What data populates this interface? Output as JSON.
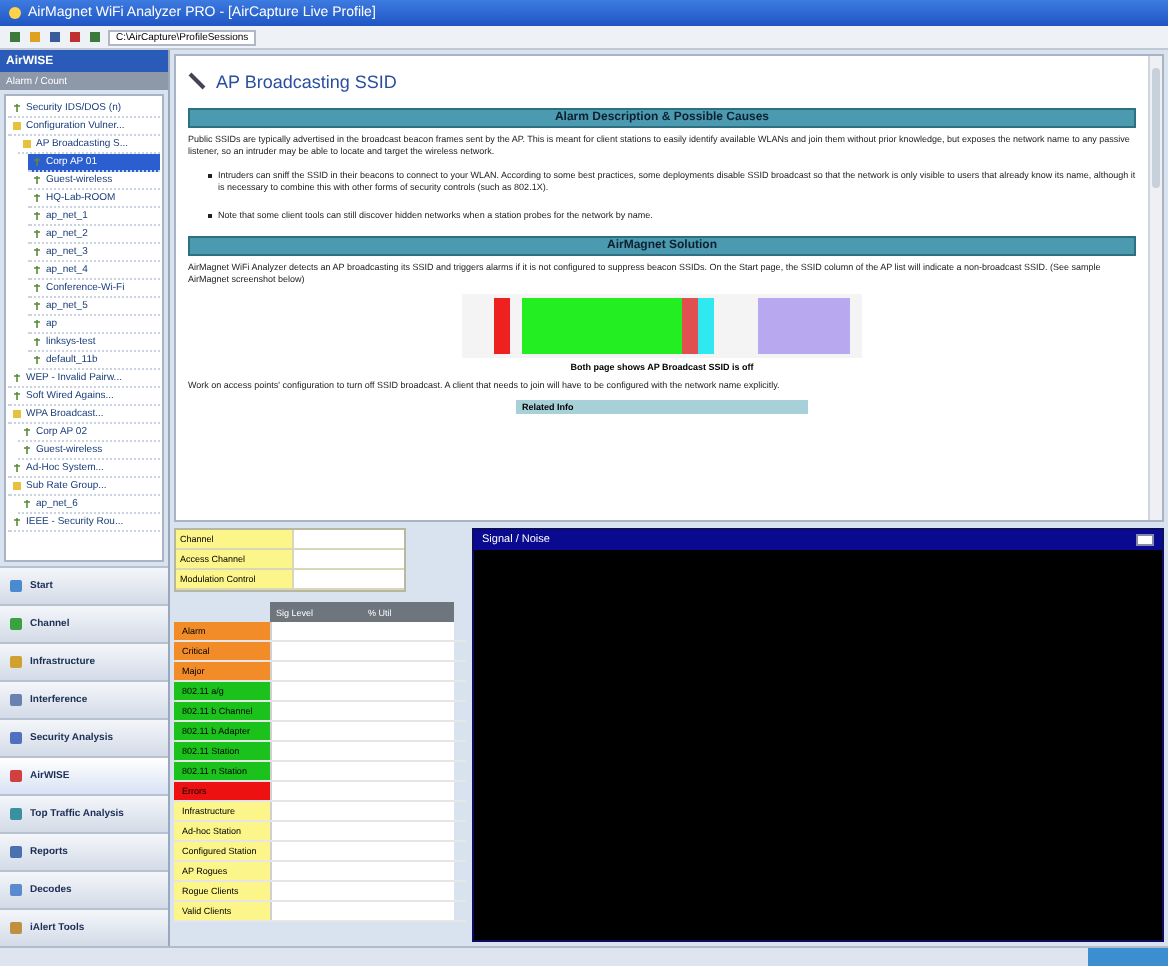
{
  "window": {
    "title": "AirMagnet WiFi Analyzer PRO - [AirCapture Live Profile]"
  },
  "toolbar": {
    "address": "C:\\AirCapture\\ProfileSessions"
  },
  "sidebar": {
    "header": "AirWISE",
    "subheader": "Alarm / Count",
    "tree": [
      {
        "label": "Security IDS/DOS (n)",
        "selected": false
      },
      {
        "label": "Configuration Vulner...",
        "selected": false,
        "children": [
          {
            "label": "AP Broadcasting S...",
            "selected": false,
            "children": [
              {
                "label": "Corp AP 01",
                "selected": true
              },
              {
                "label": "Guest-wireless",
                "selected": false
              },
              {
                "label": "HQ-Lab-ROOM",
                "selected": false
              },
              {
                "label": "ap_net_1",
                "selected": false
              },
              {
                "label": "ap_net_2",
                "selected": false
              },
              {
                "label": "ap_net_3",
                "selected": false
              },
              {
                "label": "ap_net_4",
                "selected": false
              },
              {
                "label": "Conference-Wi-Fi",
                "selected": false
              },
              {
                "label": "ap_net_5",
                "selected": false
              },
              {
                "label": "ap",
                "selected": false
              },
              {
                "label": "linksys-test",
                "selected": false
              },
              {
                "label": "default_11b",
                "selected": false
              }
            ]
          }
        ]
      },
      {
        "label": "WEP - Invalid Pairw...",
        "selected": false
      },
      {
        "label": "Soft Wired Agains...",
        "selected": false
      },
      {
        "label": "WPA Broadcast...",
        "selected": false,
        "children": [
          {
            "label": "Corp AP 02",
            "selected": false
          },
          {
            "label": "Guest-wireless",
            "selected": false
          }
        ]
      },
      {
        "label": "Ad-Hoc System...",
        "selected": false
      },
      {
        "label": "Sub Rate Group...",
        "selected": false,
        "children": [
          {
            "label": "ap_net_6",
            "selected": false
          }
        ]
      },
      {
        "label": "IEEE - Security Rou...",
        "selected": false
      }
    ],
    "nav": [
      {
        "label": "Start",
        "selected": false
      },
      {
        "label": "Channel",
        "selected": false
      },
      {
        "label": "Infrastructure",
        "selected": false
      },
      {
        "label": "Interference",
        "selected": false
      },
      {
        "label": "Security Analysis",
        "selected": false
      },
      {
        "label": "AirWISE",
        "selected": true
      },
      {
        "label": "Top Traffic Analysis",
        "selected": false
      },
      {
        "label": "Reports",
        "selected": false
      },
      {
        "label": "Decodes",
        "selected": false
      },
      {
        "label": "iAlert Tools",
        "selected": false
      }
    ]
  },
  "document": {
    "title": "AP Broadcasting SSID",
    "sections": [
      {
        "heading": "Alarm Description & Possible Causes",
        "paragraphs": [
          "Public SSIDs are typically advertised in the broadcast beacon frames sent by the AP. This is meant for client stations to easily identify available WLANs and join them without prior knowledge, but exposes the network name to any passive listener, so an intruder may be able to locate and target the wireless network."
        ],
        "bullets": [
          "Intruders can sniff the SSID in their beacons to connect to your WLAN. According to some best practices, some deployments disable SSID broadcast so that the network is only visible to users that already know its name, although it is necessary to combine this with other forms of security controls (such as 802.1X).",
          "Note that some client tools can still discover hidden networks when a station probes for the network by name."
        ]
      },
      {
        "heading": "AirMagnet Solution",
        "paragraphs": [
          "AirMagnet WiFi Analyzer detects an AP broadcasting its SSID and triggers alarms if it is not configured to suppress beacon SSIDs. On the Start page, the SSID column of the AP list will indicate a non-broadcast SSID. (See sample AirMagnet screenshot below)"
        ],
        "figure_caption": "Both page shows AP Broadcast SSID is off",
        "after": "Work on access points' configuration to turn off SSID broadcast. A client that needs to join will have to be configured with the network name explicitly.",
        "table_header": "Related Info"
      }
    ]
  },
  "info_table": [
    {
      "label": "Channel"
    },
    {
      "label": "Access Channel"
    },
    {
      "label": "Modulation Control"
    }
  ],
  "grid": {
    "columns": [
      "Sig Level",
      "% Util"
    ],
    "rows": [
      {
        "label": "Alarm",
        "color": "#f28c28"
      },
      {
        "label": "Critical",
        "color": "#f28c28"
      },
      {
        "label": "Major",
        "color": "#f28c28"
      },
      {
        "label": "802.11 a/g",
        "color": "#1cc21c"
      },
      {
        "label": "802.11 b Channel",
        "color": "#1cc21c"
      },
      {
        "label": "802.11 b Adapter",
        "color": "#1cc21c"
      },
      {
        "label": "802.11 Station",
        "color": "#1cc21c"
      },
      {
        "label": "802.11 n Station",
        "color": "#1cc21c"
      },
      {
        "label": "Errors",
        "color": "#ee1111"
      },
      {
        "label": "Infrastructure",
        "color": "#fbf58a"
      },
      {
        "label": "Ad-hoc Station",
        "color": "#fbf58a"
      },
      {
        "label": "Configured Station",
        "color": "#fbf58a"
      },
      {
        "label": "AP Rogues",
        "color": "#fbf58a"
      },
      {
        "label": "Rogue Clients",
        "color": "#fbf58a"
      },
      {
        "label": "Valid Clients",
        "color": "#fbf58a"
      }
    ]
  },
  "signal_panel": {
    "title": "Signal / Noise"
  }
}
